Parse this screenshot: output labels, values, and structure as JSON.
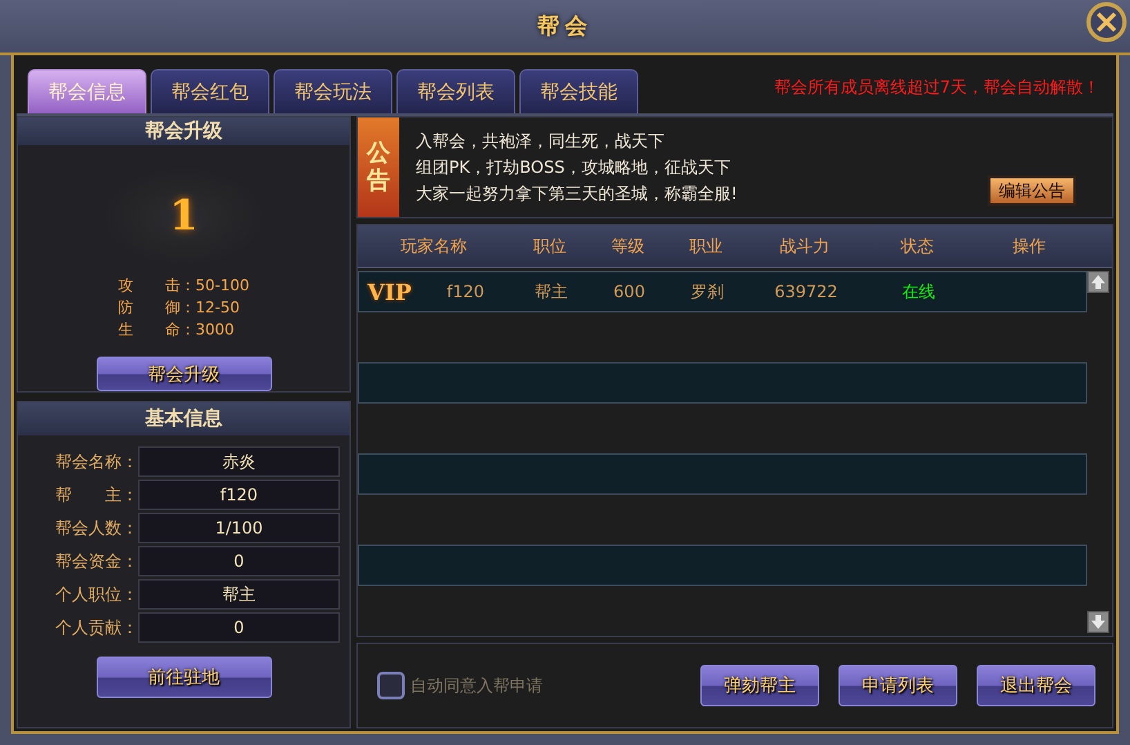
{
  "window": {
    "title": "帮会"
  },
  "tabs": [
    {
      "label": "帮会信息",
      "selected": true
    },
    {
      "label": "帮会红包",
      "selected": false
    },
    {
      "label": "帮会玩法",
      "selected": false
    },
    {
      "label": "帮会列表",
      "selected": false
    },
    {
      "label": "帮会技能",
      "selected": false
    }
  ],
  "warning": "帮会所有成员离线超过7天，帮会自动解散！",
  "upgrade": {
    "title": "帮会升级",
    "level": "1",
    "stats": [
      {
        "first": "攻",
        "rest": "击：50-100"
      },
      {
        "first": "防",
        "rest": "御：12-50"
      },
      {
        "first": "生",
        "rest": "命：3000"
      }
    ],
    "button": "帮会升级"
  },
  "basic_info": {
    "title": "基本信息",
    "fields": [
      {
        "label": "帮会名称：",
        "value": "赤炎"
      },
      {
        "label": "帮　　主：",
        "value": "f120"
      },
      {
        "label": "帮会人数：",
        "value": "1/100"
      },
      {
        "label": "帮会资金：",
        "value": "0"
      },
      {
        "label": "个人职位：",
        "value": "帮主"
      },
      {
        "label": "个人贡献：",
        "value": "0"
      }
    ],
    "button": "前往驻地"
  },
  "notice": {
    "badge": "公告",
    "lines": [
      "入帮会，共袍泽，同生死，战天下",
      "组团PK，打劫BOSS，攻城略地，征战天下",
      "大家一起努力拿下第三天的圣城，称霸全服!"
    ],
    "edit_button": "编辑公告"
  },
  "table": {
    "columns": [
      "玩家名称",
      "职位",
      "等级",
      "职业",
      "战斗力",
      "状态",
      "操作"
    ],
    "rows": [
      {
        "vip": "VIP",
        "name": "f120",
        "position": "帮主",
        "level": "600",
        "class": "罗刹",
        "power": "639722",
        "status": "在线",
        "online": true
      }
    ]
  },
  "auto_accept": {
    "label": "自动同意入帮申请",
    "checked": false
  },
  "buttons": [
    "弹劾帮主",
    "申请列表",
    "退出帮会"
  ]
}
